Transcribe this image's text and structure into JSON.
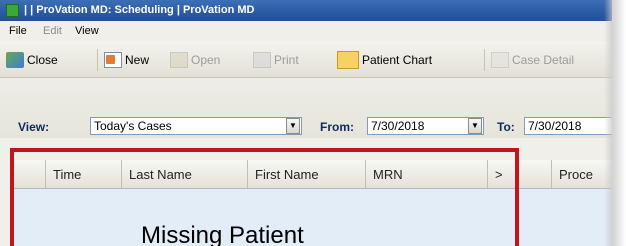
{
  "window": {
    "title": "| | ProVation MD: Scheduling | ProVation MD"
  },
  "menu": {
    "file": "File",
    "edit": "Edit",
    "view": "View"
  },
  "toolbar": {
    "close": "Close",
    "new": "New",
    "open": "Open",
    "print": "Print",
    "patient_chart": "Patient Chart",
    "case_detail": "Case Detail"
  },
  "filters": {
    "view_label": "View:",
    "view_value": "Today's Cases",
    "from_label": "From:",
    "from_value": "7/30/2018",
    "to_label": "To:",
    "to_value": "7/30/2018"
  },
  "grid": {
    "columns": [
      "",
      "Time",
      "Last Name",
      "First Name",
      "MRN",
      ">",
      "Proce"
    ]
  },
  "annotation": {
    "text": "Missing Patient",
    "color": "#c0161b"
  }
}
